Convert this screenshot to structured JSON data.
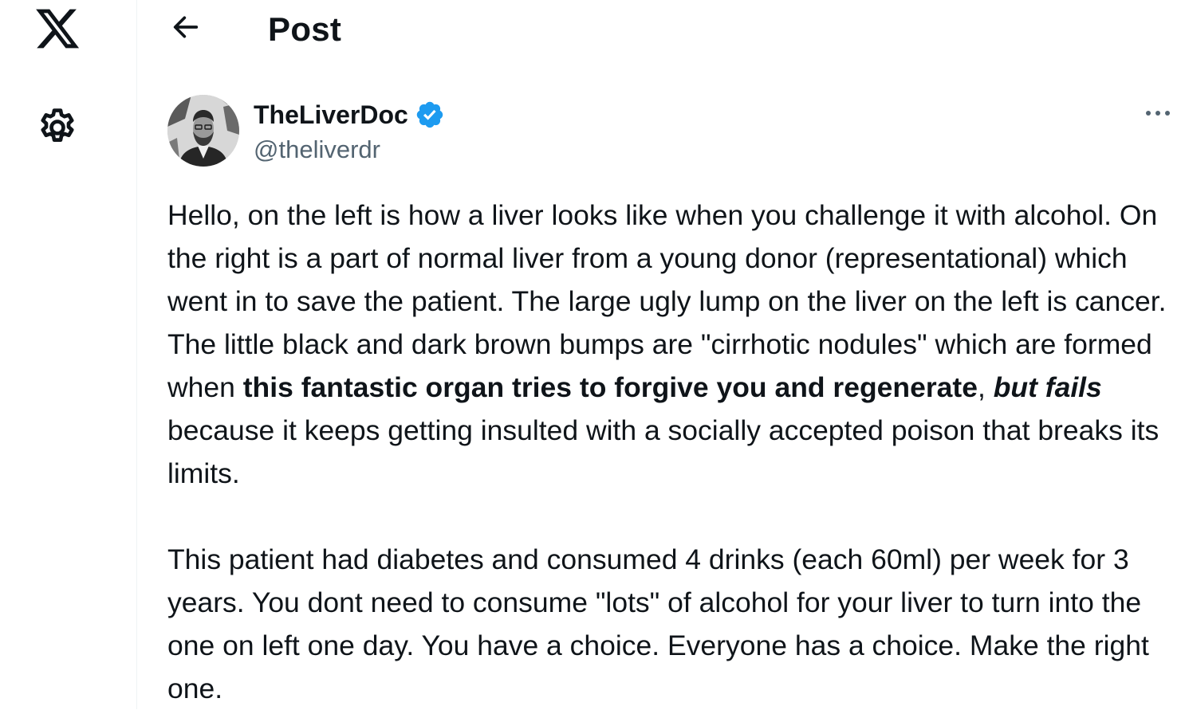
{
  "left_nav": {
    "logo_icon": "x-logo-icon",
    "settings_icon": "gear-icon"
  },
  "header": {
    "back_icon": "arrow-left-icon",
    "title": "Post"
  },
  "post": {
    "author": {
      "display_name": "TheLiverDoc",
      "verified": true,
      "verified_color": "#1d9bf0",
      "handle": "@theliverdr"
    },
    "more_icon": "more-horizontal-icon",
    "paragraph1": {
      "text_a": "Hello, on the left is how a liver looks like when you challenge it with alcohol. On the right is a part of normal liver from a young donor (representational) which went in to save the patient. The large ugly lump on the liver on the left is cancer. The little black and dark brown bumps are \"cirrhotic nodules\" which are formed when ",
      "bold_a": "this fantastic organ tries to forgive you and regenerate",
      "comma": ", ",
      "bold_italic": "but fails",
      "text_b": " because it keeps getting insulted with a socially accepted poison that breaks its limits."
    },
    "paragraph2": "This patient had diabetes and consumed 4 drinks (each 60ml) per week for 3 years. You dont need to consume \"lots\" of alcohol for your liver to turn into the one on left one day. You have a choice. Everyone has a choice. Make the right one."
  },
  "colors": {
    "text": "#0f1419",
    "secondary_text": "#536471",
    "divider": "#eff3f4"
  }
}
